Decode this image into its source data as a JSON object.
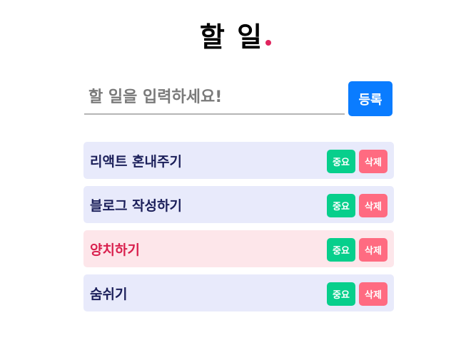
{
  "header": {
    "title": "할 일"
  },
  "form": {
    "input_placeholder": "할 일을 입력하세요!",
    "input_value": "",
    "submit_label": "등록"
  },
  "todos": [
    {
      "text": "리액트 혼내주기",
      "important": false,
      "important_label": "중요",
      "delete_label": "삭제"
    },
    {
      "text": "블로그 작성하기",
      "important": false,
      "important_label": "중요",
      "delete_label": "삭제"
    },
    {
      "text": "양치하기",
      "important": true,
      "important_label": "중요",
      "delete_label": "삭제"
    },
    {
      "text": "숨쉬기",
      "important": false,
      "important_label": "중요",
      "delete_label": "삭제"
    }
  ],
  "colors": {
    "accent_dot": "#e0245e",
    "submit_button": "#0a7cff",
    "important_button": "#07cf8c",
    "delete_button": "#ff6b81",
    "item_background": "#e8eafb",
    "important_item_background": "#fde6ea",
    "important_item_text": "#d9204e"
  }
}
